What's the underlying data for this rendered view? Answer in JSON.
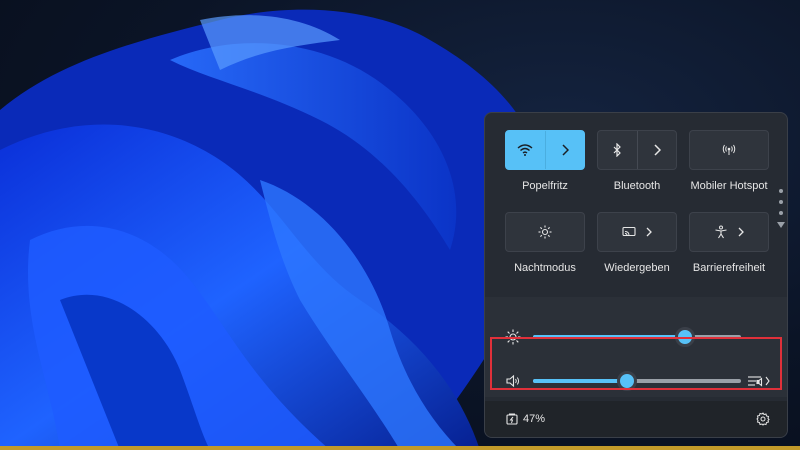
{
  "quick_settings": {
    "tiles": [
      {
        "label": "Popelfritz",
        "icon": "wifi-icon",
        "active": true,
        "expandable": true
      },
      {
        "label": "Bluetooth",
        "icon": "bluetooth-icon",
        "active": false,
        "expandable": true
      },
      {
        "label": "Mobiler Hotspot",
        "icon": "hotspot-icon",
        "active": false,
        "expandable": false
      },
      {
        "label": "Nachtmodus",
        "icon": "night-mode-icon",
        "active": false,
        "expandable": false
      },
      {
        "label": "Wiedergeben",
        "icon": "cast-icon",
        "active": false,
        "expandable": true
      },
      {
        "label": "Barrierefreiheit",
        "icon": "accessibility-icon",
        "active": false,
        "expandable": true
      }
    ],
    "pages": 3,
    "brightness": {
      "icon": "brightness-icon",
      "level": 0.73
    },
    "volume": {
      "icon": "speaker-icon",
      "level": 0.45,
      "output_icon": "audio-output-icon"
    },
    "battery": {
      "icon": "battery-charging-icon",
      "percent_label": "47%"
    },
    "settings_icon": "gear-icon"
  },
  "colors": {
    "accent": "#57c1f7",
    "panel": "#262b33",
    "highlight": "#e0303a",
    "taskbar_accent": "#c29a2a"
  }
}
